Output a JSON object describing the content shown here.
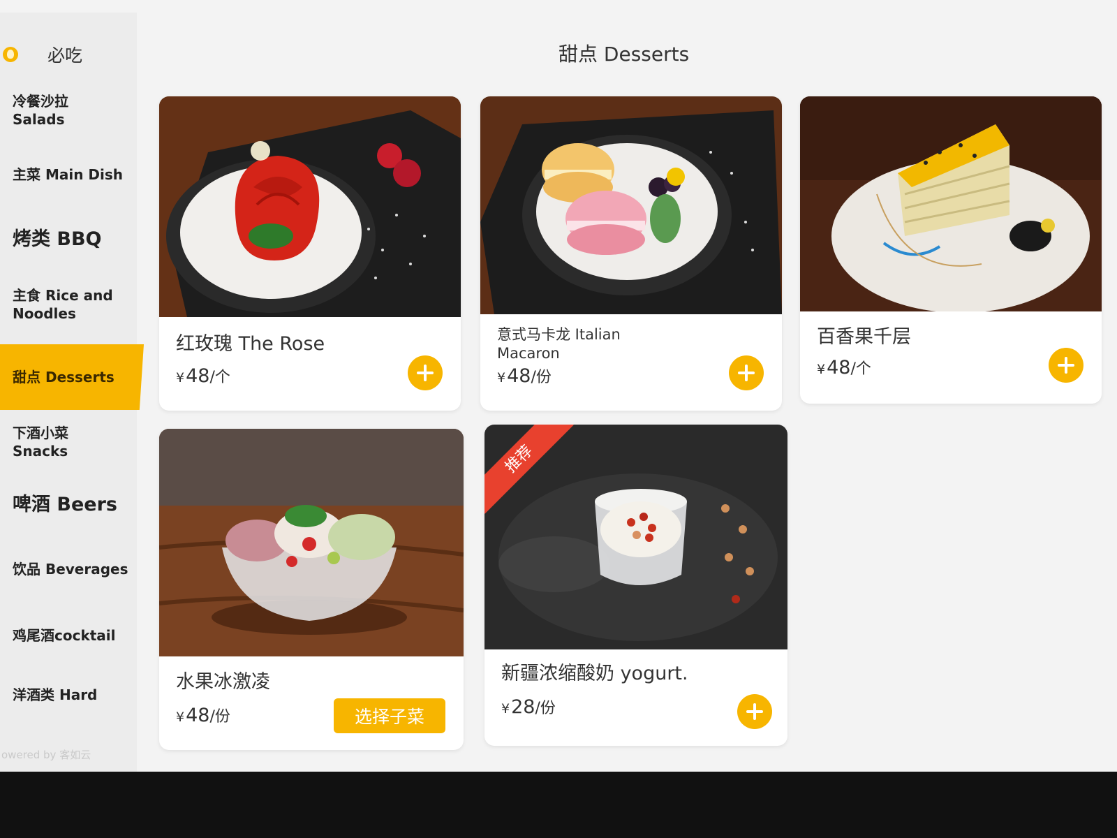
{
  "sidebar": {
    "items": [
      {
        "label": "必吃"
      },
      {
        "label_line1": "冷餐沙拉",
        "label_line2": "Salads"
      },
      {
        "label": "主菜 Main Dish"
      },
      {
        "label": "烤类 BBQ"
      },
      {
        "label_line1": "主食 Rice and",
        "label_line2": "Noodles"
      },
      {
        "label": "甜点 Desserts"
      },
      {
        "label_line1": "下酒小菜",
        "label_line2": "Snacks"
      },
      {
        "label": "啤酒 Beers"
      },
      {
        "label": "饮品 Beverages"
      },
      {
        "label": "鸡尾酒cocktail"
      },
      {
        "label": "洋酒类 Hard"
      }
    ],
    "active_index": 5,
    "powered_by": "owered by 客如云"
  },
  "main": {
    "title": "甜点 Desserts",
    "dishes": [
      {
        "name": "红玫瑰 The Rose",
        "currency": "¥",
        "price": "48",
        "unit": "/个",
        "action": "add"
      },
      {
        "name_line1": "意式马卡龙 Italian",
        "name_line2": "Macaron",
        "currency": "¥",
        "price": "48",
        "unit": "/份",
        "action": "add"
      },
      {
        "name": "百香果千层",
        "currency": "¥",
        "price": "48",
        "unit": "/个",
        "action": "add"
      },
      {
        "name": "水果冰激凌",
        "currency": "¥",
        "price": "48",
        "unit": "/份",
        "action": "choose",
        "choose_label": "选择子菜"
      },
      {
        "name": "新疆浓缩酸奶 yogurt.",
        "currency": "¥",
        "price": "28",
        "unit": "/份",
        "action": "add",
        "badge": "推荐"
      }
    ]
  },
  "colors": {
    "accent": "#f7b500",
    "badge": "#e8412e",
    "sidebar_bg": "#ececec",
    "page_bg": "#f3f3f3"
  }
}
